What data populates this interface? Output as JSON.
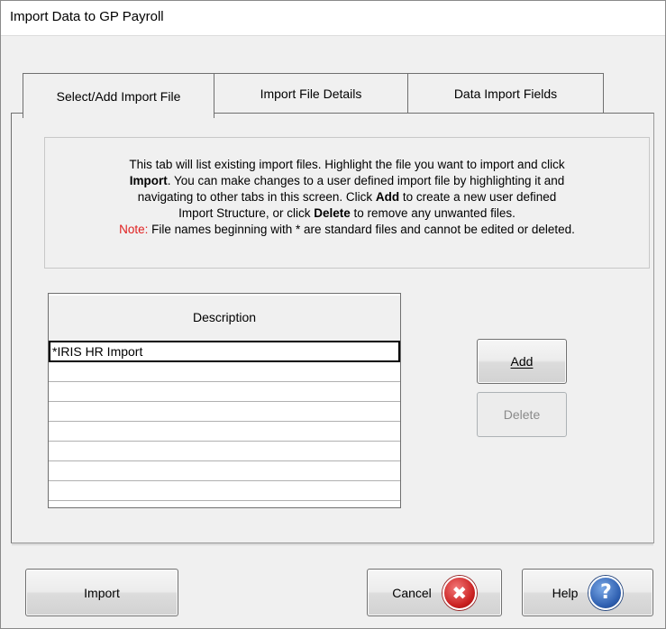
{
  "window": {
    "title": "Import Data to GP Payroll"
  },
  "tabs": [
    {
      "label": "Select/Add Import File",
      "active": true
    },
    {
      "label": "Import File Details",
      "active": false
    },
    {
      "label": "Data Import Fields",
      "active": false
    }
  ],
  "info": {
    "line1": "This tab will list existing import files.  Highlight the file you want to import and click",
    "line2_bold": "Import",
    "line2_rest": ". You can make changes to a user defined import file by highlighting it and",
    "line3_pre": "navigating to other tabs in this screen.  Click ",
    "line3_bold": "Add",
    "line3_post": " to create a new user defined",
    "line4_pre": "Import Structure, or click ",
    "line4_bold": "Delete",
    "line4_post": " to remove any unwanted files.",
    "note_label": "Note:",
    "note_text": "  File names beginning with * are standard files and cannot be edited or deleted."
  },
  "grid": {
    "header": "Description",
    "rows": [
      "*IRIS HR Import",
      "",
      "",
      "",
      "",
      "",
      "",
      ""
    ]
  },
  "buttons": {
    "add": "Add",
    "delete": "Delete",
    "import": "Import",
    "cancel": "Cancel",
    "help": "Help"
  },
  "icons": {
    "cancel": "✖",
    "help": "?"
  },
  "colors": {
    "note": "#e02020",
    "cancel_icon": "#c91f1f",
    "help_icon": "#2e5fb0"
  }
}
